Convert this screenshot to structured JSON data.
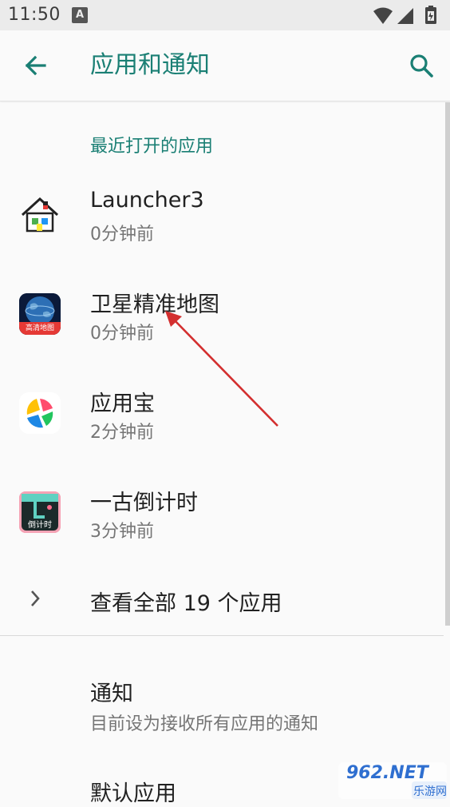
{
  "status_bar": {
    "time": "11:50",
    "notification_icon": "A"
  },
  "app_bar": {
    "title": "应用和通知",
    "back_icon": "arrow-left-icon",
    "search_icon": "search-icon",
    "accent_color": "#1a7f74"
  },
  "recent_apps": {
    "header": "最近打开的应用",
    "items": [
      {
        "name": "Launcher3",
        "time": "0分钟前",
        "icon": "house-icon"
      },
      {
        "name": "卫星精准地图",
        "time": "0分钟前",
        "icon": "globe-map-icon",
        "icon_label": "高清地图"
      },
      {
        "name": "应用宝",
        "time": "2分钟前",
        "icon": "app-store-icon"
      },
      {
        "name": "一古倒计时",
        "time": "3分钟前",
        "icon": "countdown-icon",
        "icon_label": "倒计时"
      }
    ]
  },
  "see_all": {
    "label": "查看全部 19 个应用",
    "icon": "chevron-right-icon"
  },
  "prefs": [
    {
      "title": "通知",
      "summary": "目前设为接收所有应用的通知"
    },
    {
      "title": "默认应用"
    }
  ],
  "watermark": {
    "brand": "962.NET",
    "sub": "乐游网"
  }
}
